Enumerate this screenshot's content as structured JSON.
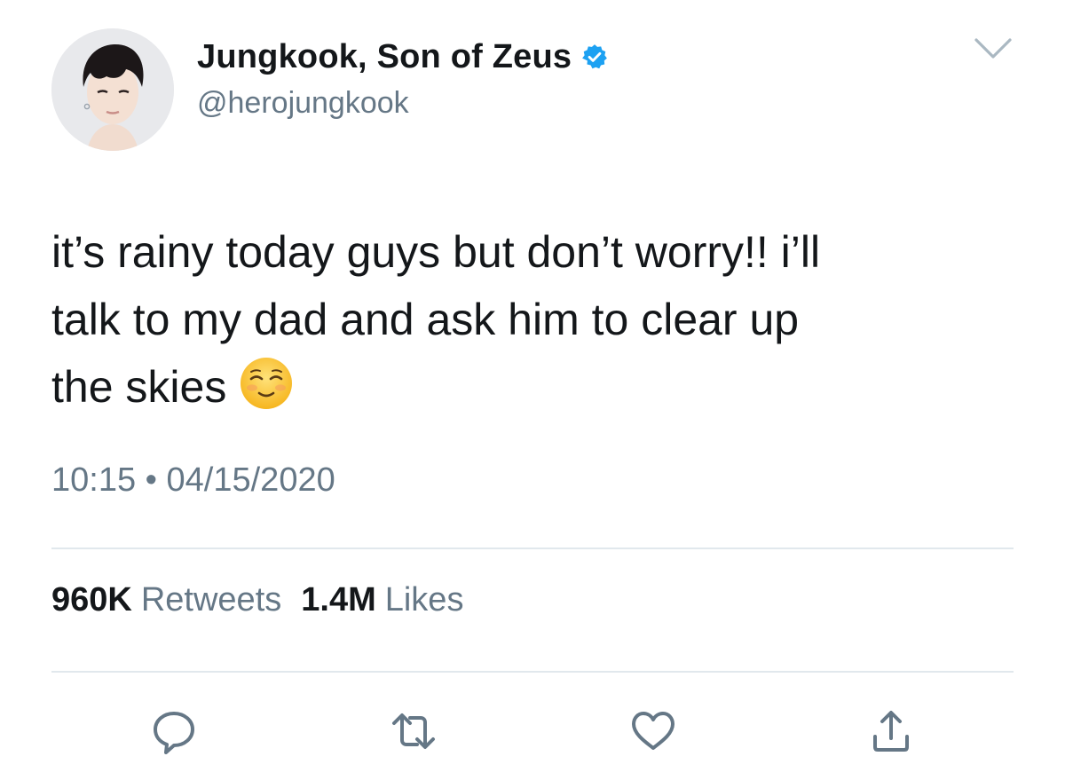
{
  "user": {
    "display_name": "Jungkook, Son of Zeus",
    "handle": "@herojungkook",
    "verified_icon": "verified-badge-icon",
    "verified_color": "#1da1f2"
  },
  "tweet": {
    "text": "it’s rainy today guys but don’t worry!! i’ll\ntalk to my dad and ask him to clear up\nthe skies",
    "emoji": "smiling-face-icon"
  },
  "timestamp": {
    "time": "10:15",
    "separator": "•",
    "date": "04/15/2020"
  },
  "stats": {
    "retweets_count": "960K",
    "retweets_label": "Retweets",
    "likes_count": "1.4M",
    "likes_label": "Likes"
  },
  "actions": {
    "reply_icon": "reply-icon",
    "retweet_icon": "retweet-icon",
    "like_icon": "heart-icon",
    "share_icon": "share-icon"
  },
  "colors": {
    "text_primary": "#14171a",
    "text_secondary": "#657786",
    "divider": "#e1e8ed",
    "icon_gray": "#657786"
  }
}
